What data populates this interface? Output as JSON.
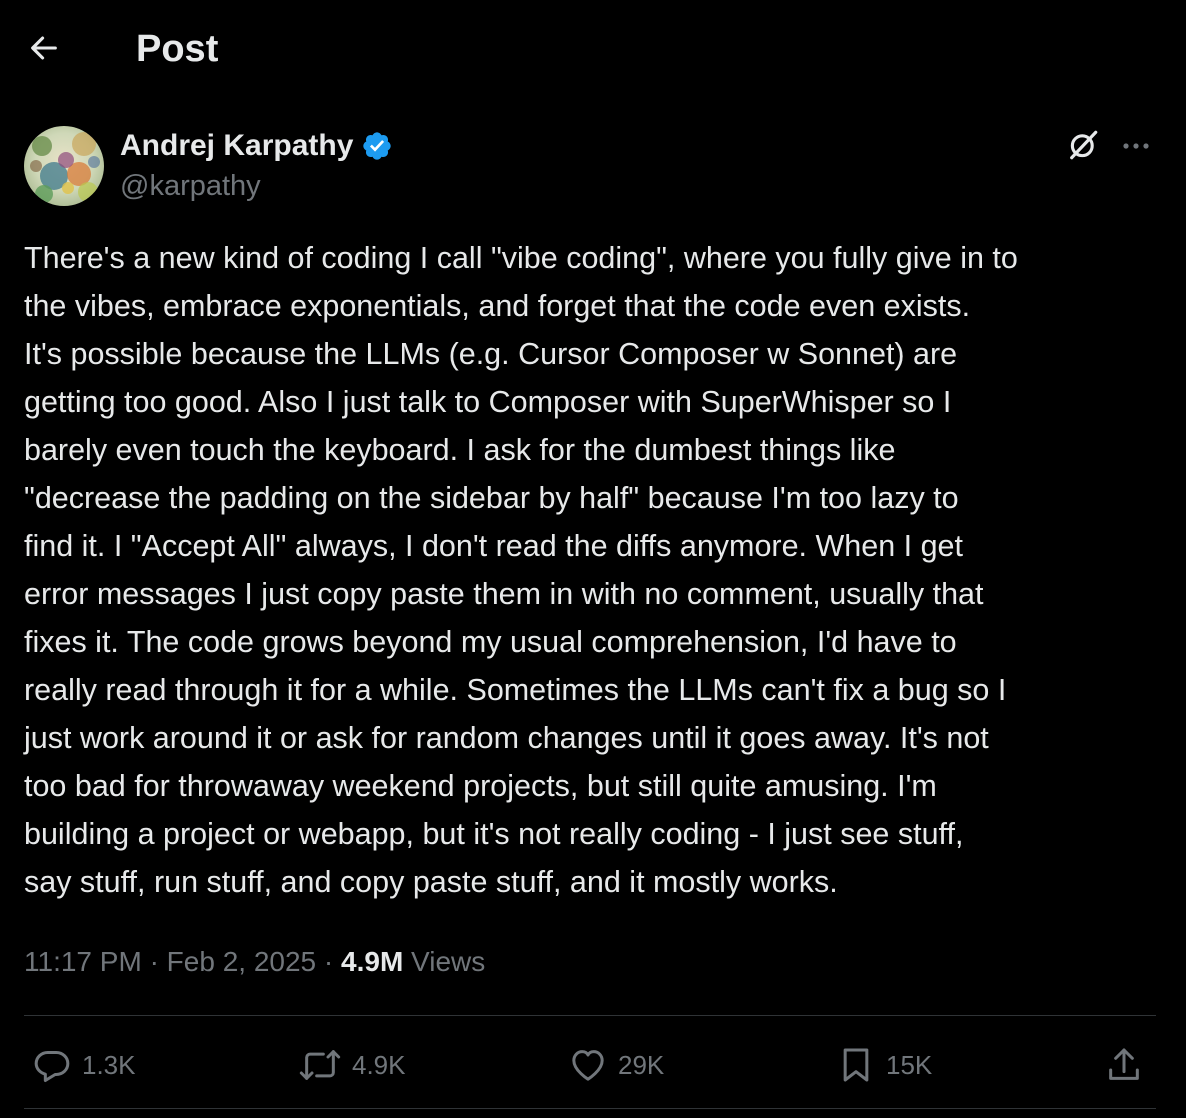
{
  "header": {
    "title": "Post"
  },
  "author": {
    "name": "Andrej Karpathy",
    "handle": "@karpathy"
  },
  "post": {
    "lines": [
      "There's a new kind of coding I call \"vibe coding\", where you fully give in to",
      "the vibes, embrace exponentials, and forget that the code even exists.",
      "It's possible because the LLMs (e.g. Cursor Composer w Sonnet) are",
      "getting too good. Also I just talk to Composer with SuperWhisper so I",
      "barely even touch the keyboard. I ask for the dumbest things like",
      "\"decrease the padding on the sidebar by half\" because I'm too lazy to",
      "find it. I \"Accept All\" always, I don't read the diffs anymore. When I get",
      "error messages I just copy paste them in with no comment, usually that",
      "fixes it. The code grows beyond my usual comprehension, I'd have to",
      "really read through it for a while. Sometimes the LLMs can't fix a bug so I",
      "just work around it or ask for random changes until it goes away. It's not",
      "too bad for throwaway weekend projects, but still quite amusing. I'm",
      "building a project or webapp, but it's not really coding - I just see stuff,",
      "say stuff, run stuff, and copy paste stuff, and it mostly works."
    ],
    "time": "11:17 PM",
    "date": "Feb 2, 2025",
    "separator": "·",
    "views_count": "4.9M",
    "views_label": "Views"
  },
  "actions": {
    "replies": "1.3K",
    "reposts": "4.9K",
    "likes": "29K",
    "bookmarks": "15K"
  },
  "icons": {
    "back": "arrow-left-icon",
    "verified": "verified-badge-icon",
    "grok": "grok-icon",
    "more": "more-dots-icon",
    "reply": "reply-icon",
    "repost": "repost-icon",
    "like": "heart-icon",
    "bookmark": "bookmark-icon",
    "share": "share-icon"
  },
  "colors": {
    "background": "#000000",
    "text_primary": "#e7e9ea",
    "text_secondary": "#71767b",
    "divider": "#2f3336",
    "verified": "#1d9bf0"
  }
}
